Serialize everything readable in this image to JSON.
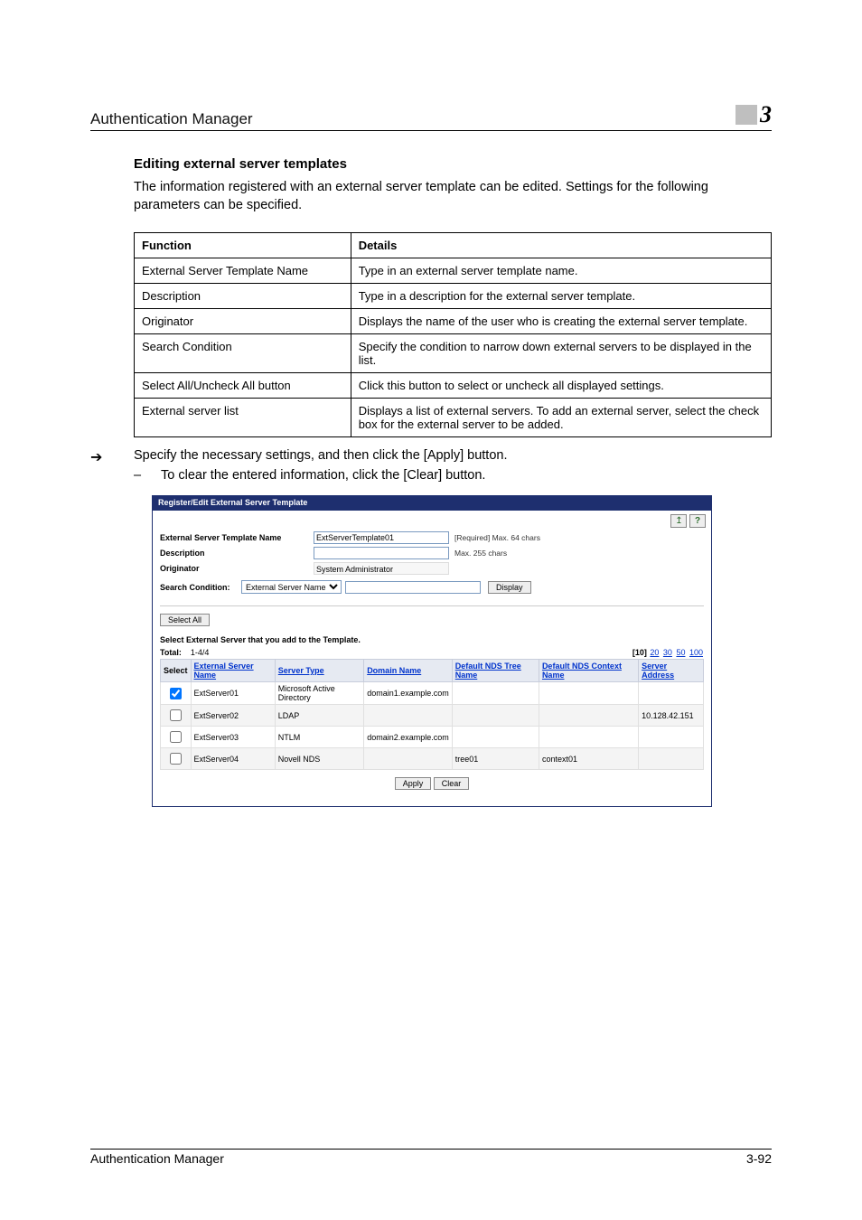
{
  "header": {
    "title": "Authentication Manager",
    "chapter": "3"
  },
  "section": {
    "heading": "Editing external server templates",
    "intro": "The information registered with an external server template can be edited. Settings for the following parameters can be specified."
  },
  "func_table": {
    "head_function": "Function",
    "head_details": "Details",
    "rows": [
      {
        "f": "External Server Template Name",
        "d": "Type in an external server template name."
      },
      {
        "f": "Description",
        "d": "Type in a description for the external server template."
      },
      {
        "f": "Originator",
        "d": "Displays the name of the user who is creating the external server template."
      },
      {
        "f": "Search Condition",
        "d": "Specify the condition to narrow down external servers to be displayed in the list."
      },
      {
        "f": "Select All/Uncheck All button",
        "d": "Click this button to select or uncheck all displayed settings."
      },
      {
        "f": "External server list",
        "d": "Displays a list of external servers. To add an external server, select the check box for the external server to be added."
      }
    ]
  },
  "step": {
    "arrow": "➔",
    "text": "Specify the necessary settings, and then click the [Apply] button.",
    "dash": "–",
    "subtext": "To clear the entered information, click the [Clear] button."
  },
  "screenshot": {
    "title": "Register/Edit External Server Template",
    "back_icon": "↥",
    "help_icon": "?",
    "labels": {
      "template_name": "External Server Template Name",
      "description": "Description",
      "originator": "Originator",
      "search_condition": "Search Condition:"
    },
    "values": {
      "template_name": "ExtServerTemplate01",
      "template_name_hint": "[Required] Max. 64 chars",
      "description": "",
      "description_hint": "Max. 255 chars",
      "originator": "System Administrator",
      "search_select": "External Server Name",
      "search_input": "",
      "display_btn": "Display",
      "select_all_btn": "Select All",
      "add_instruction": "Select External Server that you add to the Template.",
      "total_label": "Total:",
      "total_value": "1-4/4",
      "pager_current": "[10]",
      "pager_opts": [
        "20",
        "30",
        "50",
        "100"
      ]
    },
    "table": {
      "headers": {
        "select": "Select",
        "name": "External Server Name",
        "type": "Server Type",
        "domain": "Domain Name",
        "tree": "Default NDS Tree Name",
        "context": "Default NDS Context Name",
        "addr": "Server Address"
      },
      "rows": [
        {
          "checked": true,
          "name": "ExtServer01",
          "type": "Microsoft Active Directory",
          "domain": "domain1.example.com",
          "tree": "",
          "context": "",
          "addr": ""
        },
        {
          "checked": false,
          "name": "ExtServer02",
          "type": "LDAP",
          "domain": "",
          "tree": "",
          "context": "",
          "addr": "10.128.42.151"
        },
        {
          "checked": false,
          "name": "ExtServer03",
          "type": "NTLM",
          "domain": "domain2.example.com",
          "tree": "",
          "context": "",
          "addr": ""
        },
        {
          "checked": false,
          "name": "ExtServer04",
          "type": "Novell NDS",
          "domain": "",
          "tree": "tree01",
          "context": "context01",
          "addr": ""
        }
      ]
    },
    "apply_btn": "Apply",
    "clear_btn": "Clear"
  },
  "footer": {
    "left": "Authentication Manager",
    "right": "3-92"
  }
}
